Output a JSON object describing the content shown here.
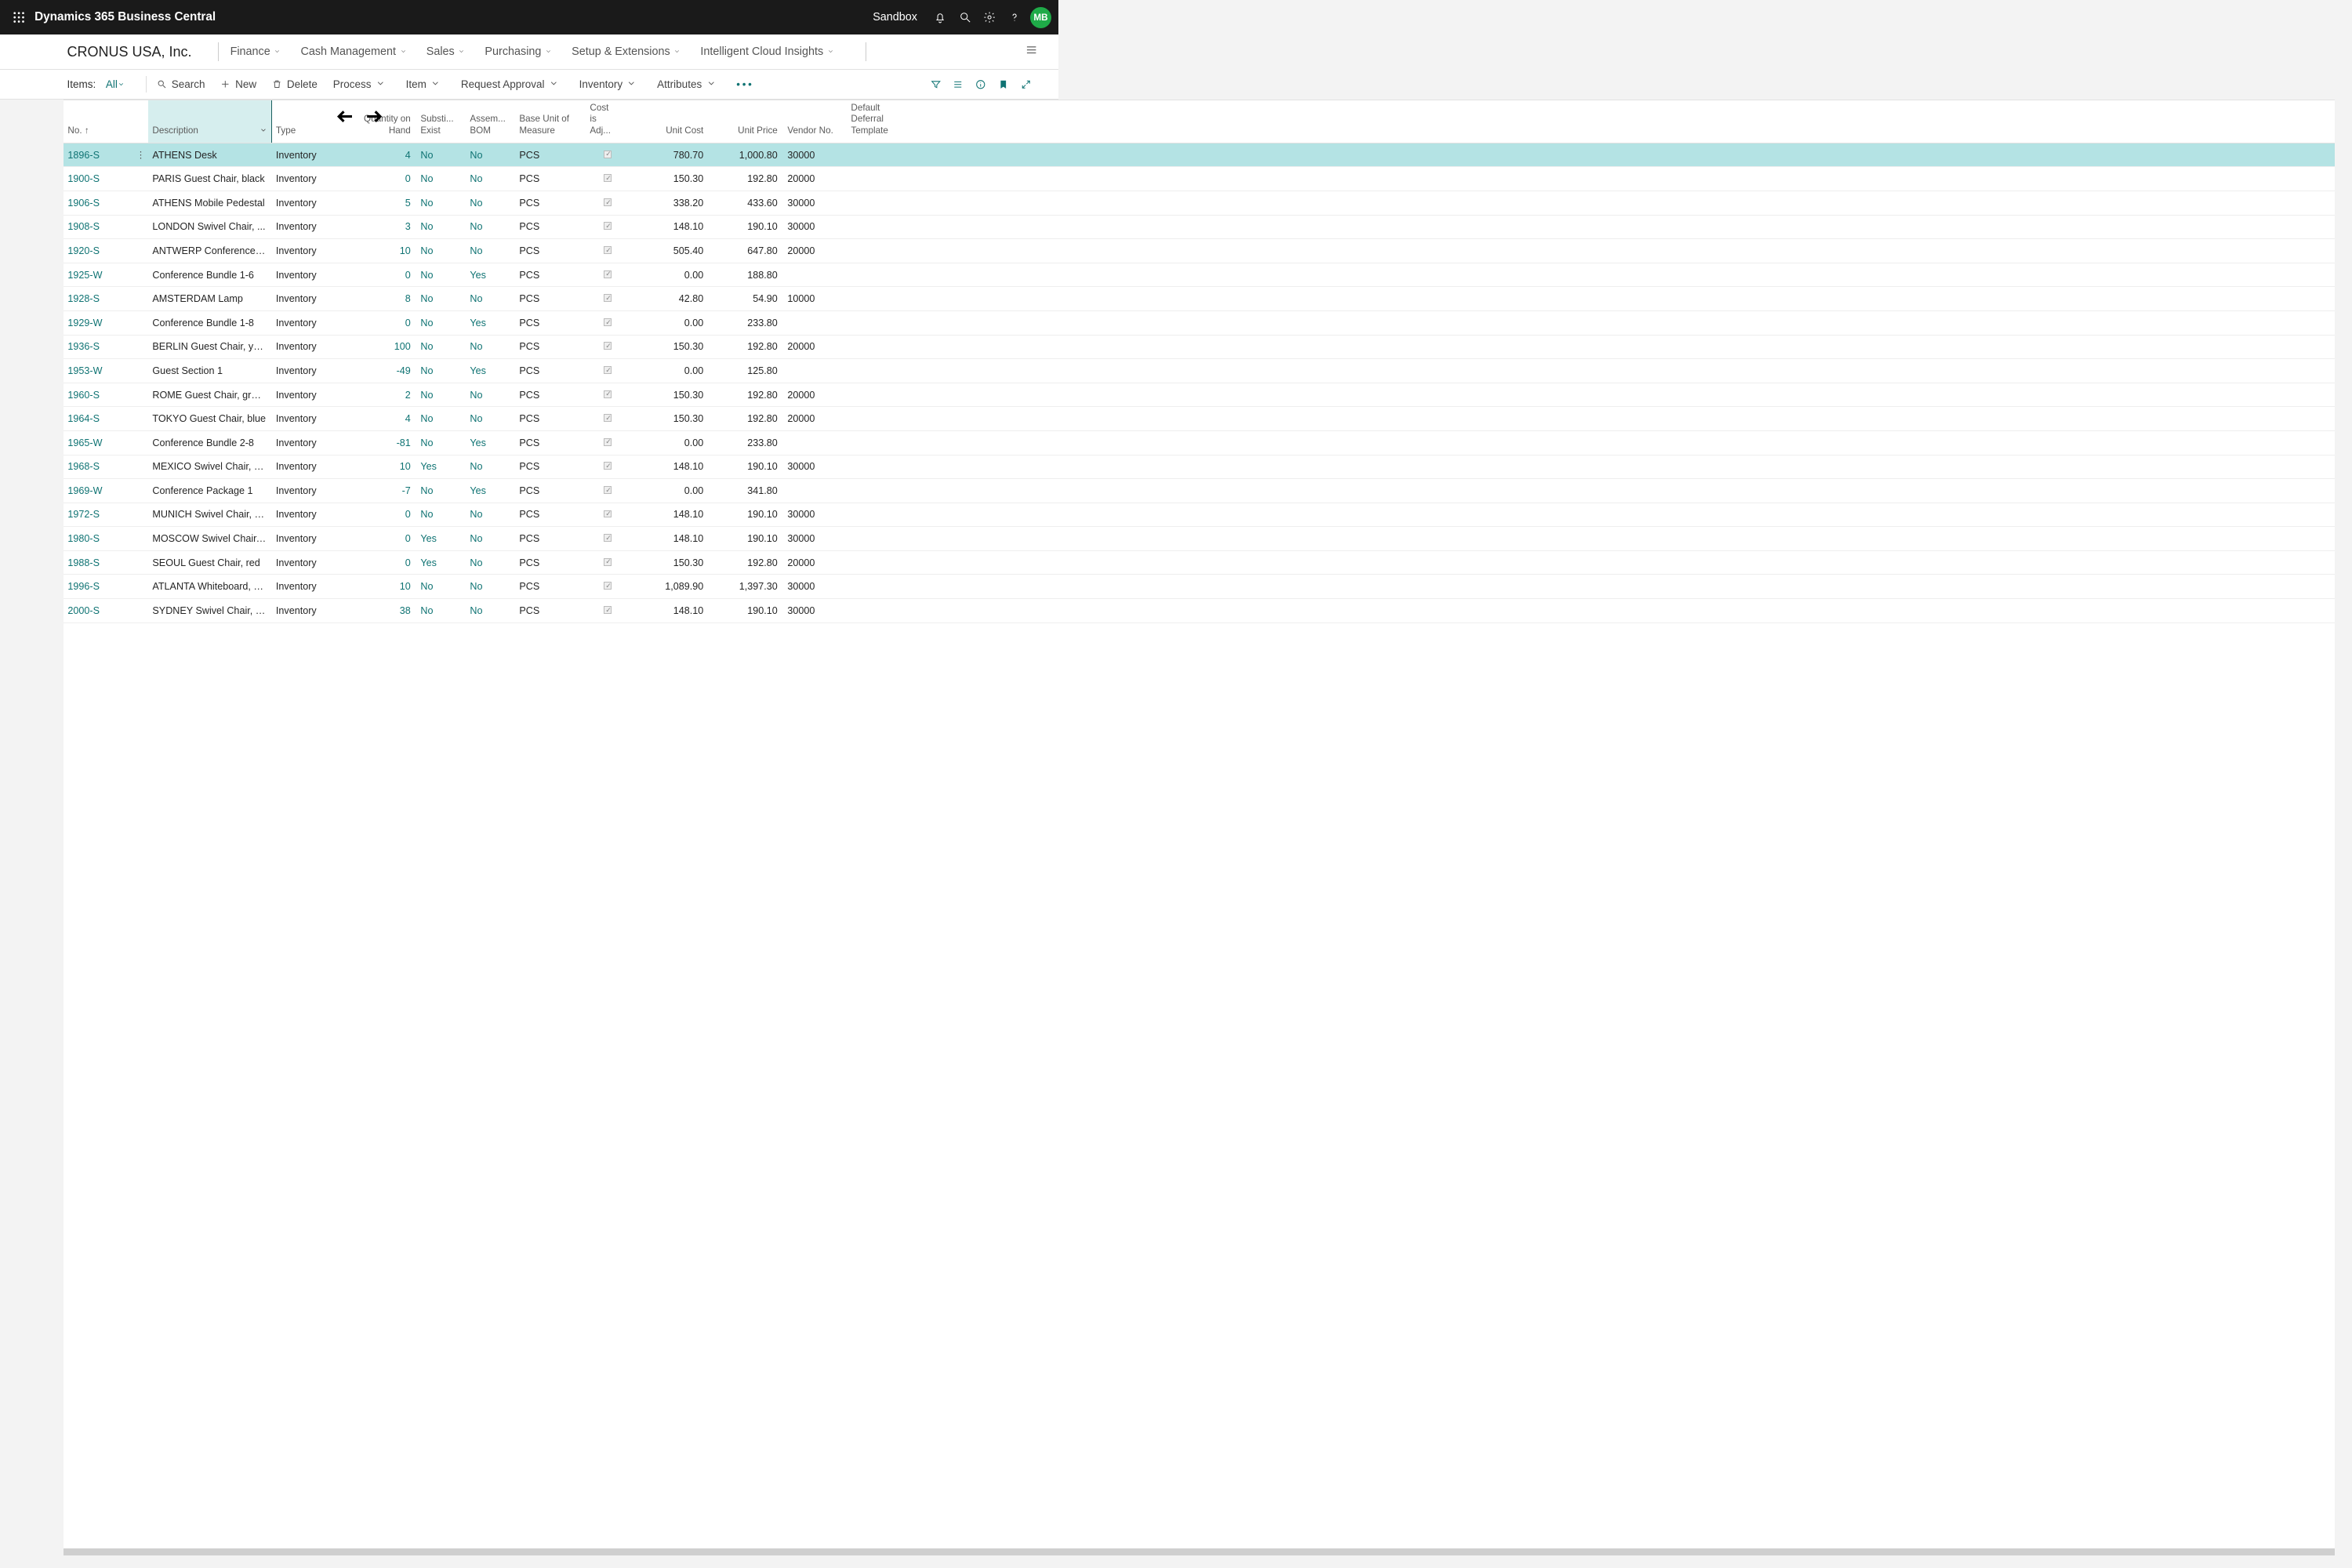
{
  "topbar": {
    "app_title": "Dynamics 365 Business Central",
    "env": "Sandbox",
    "avatar": "MB"
  },
  "nav": {
    "company": "CRONUS USA, Inc.",
    "items": [
      "Finance",
      "Cash Management",
      "Sales",
      "Purchasing",
      "Setup & Extensions",
      "Intelligent Cloud Insights"
    ]
  },
  "actionbar": {
    "label": "Items:",
    "view": "All",
    "search": "Search",
    "new": "New",
    "delete": "Delete",
    "process": "Process",
    "item": "Item",
    "request_approval": "Request Approval",
    "inventory": "Inventory",
    "attributes": "Attributes"
  },
  "columns": {
    "no": "No. ↑",
    "description": "Description",
    "type": "Type",
    "qty": "Quantity on Hand",
    "substi": "Substi...\nExist",
    "assem": "Assem...\nBOM",
    "base_unit": "Base Unit of\nMeasure",
    "cost_adj": "Cost\nis\nAdj...",
    "unit_cost": "Unit Cost",
    "unit_price": "Unit Price",
    "vendor": "Vendor No.",
    "deferral": "Default\nDeferral\nTemplate"
  },
  "rows": [
    {
      "no": "1896-S",
      "desc": "ATHENS Desk",
      "type": "Inventory",
      "qty": "4",
      "sub": "No",
      "asm": "No",
      "uom": "PCS",
      "adj": true,
      "cost": "780.70",
      "price": "1,000.80",
      "vendor": "30000",
      "def": "",
      "sel": true
    },
    {
      "no": "1900-S",
      "desc": "PARIS Guest Chair, black",
      "type": "Inventory",
      "qty": "0",
      "sub": "No",
      "asm": "No",
      "uom": "PCS",
      "adj": true,
      "cost": "150.30",
      "price": "192.80",
      "vendor": "20000",
      "def": ""
    },
    {
      "no": "1906-S",
      "desc": "ATHENS Mobile Pedestal",
      "type": "Inventory",
      "qty": "5",
      "sub": "No",
      "asm": "No",
      "uom": "PCS",
      "adj": true,
      "cost": "338.20",
      "price": "433.60",
      "vendor": "30000",
      "def": ""
    },
    {
      "no": "1908-S",
      "desc": "LONDON Swivel Chair, ...",
      "type": "Inventory",
      "qty": "3",
      "sub": "No",
      "asm": "No",
      "uom": "PCS",
      "adj": true,
      "cost": "148.10",
      "price": "190.10",
      "vendor": "30000",
      "def": ""
    },
    {
      "no": "1920-S",
      "desc": "ANTWERP Conference T...",
      "type": "Inventory",
      "qty": "10",
      "sub": "No",
      "asm": "No",
      "uom": "PCS",
      "adj": true,
      "cost": "505.40",
      "price": "647.80",
      "vendor": "20000",
      "def": ""
    },
    {
      "no": "1925-W",
      "desc": "Conference Bundle 1-6",
      "type": "Inventory",
      "qty": "0",
      "sub": "No",
      "asm": "Yes",
      "uom": "PCS",
      "adj": true,
      "cost": "0.00",
      "price": "188.80",
      "vendor": "",
      "def": ""
    },
    {
      "no": "1928-S",
      "desc": "AMSTERDAM Lamp",
      "type": "Inventory",
      "qty": "8",
      "sub": "No",
      "asm": "No",
      "uom": "PCS",
      "adj": true,
      "cost": "42.80",
      "price": "54.90",
      "vendor": "10000",
      "def": ""
    },
    {
      "no": "1929-W",
      "desc": "Conference Bundle 1-8",
      "type": "Inventory",
      "qty": "0",
      "sub": "No",
      "asm": "Yes",
      "uom": "PCS",
      "adj": true,
      "cost": "0.00",
      "price": "233.80",
      "vendor": "",
      "def": ""
    },
    {
      "no": "1936-S",
      "desc": "BERLIN Guest Chair, yell...",
      "type": "Inventory",
      "qty": "100",
      "sub": "No",
      "asm": "No",
      "uom": "PCS",
      "adj": true,
      "cost": "150.30",
      "price": "192.80",
      "vendor": "20000",
      "def": ""
    },
    {
      "no": "1953-W",
      "desc": "Guest Section 1",
      "type": "Inventory",
      "qty": "-49",
      "sub": "No",
      "asm": "Yes",
      "uom": "PCS",
      "adj": true,
      "cost": "0.00",
      "price": "125.80",
      "vendor": "",
      "def": ""
    },
    {
      "no": "1960-S",
      "desc": "ROME Guest Chair, green",
      "type": "Inventory",
      "qty": "2",
      "sub": "No",
      "asm": "No",
      "uom": "PCS",
      "adj": true,
      "cost": "150.30",
      "price": "192.80",
      "vendor": "20000",
      "def": ""
    },
    {
      "no": "1964-S",
      "desc": "TOKYO Guest Chair, blue",
      "type": "Inventory",
      "qty": "4",
      "sub": "No",
      "asm": "No",
      "uom": "PCS",
      "adj": true,
      "cost": "150.30",
      "price": "192.80",
      "vendor": "20000",
      "def": ""
    },
    {
      "no": "1965-W",
      "desc": "Conference Bundle 2-8",
      "type": "Inventory",
      "qty": "-81",
      "sub": "No",
      "asm": "Yes",
      "uom": "PCS",
      "adj": true,
      "cost": "0.00",
      "price": "233.80",
      "vendor": "",
      "def": ""
    },
    {
      "no": "1968-S",
      "desc": "MEXICO Swivel Chair, bl...",
      "type": "Inventory",
      "qty": "10",
      "sub": "Yes",
      "asm": "No",
      "uom": "PCS",
      "adj": true,
      "cost": "148.10",
      "price": "190.10",
      "vendor": "30000",
      "def": ""
    },
    {
      "no": "1969-W",
      "desc": "Conference Package 1",
      "type": "Inventory",
      "qty": "-7",
      "sub": "No",
      "asm": "Yes",
      "uom": "PCS",
      "adj": true,
      "cost": "0.00",
      "price": "341.80",
      "vendor": "",
      "def": ""
    },
    {
      "no": "1972-S",
      "desc": "MUNICH Swivel Chair, y...",
      "type": "Inventory",
      "qty": "0",
      "sub": "No",
      "asm": "No",
      "uom": "PCS",
      "adj": true,
      "cost": "148.10",
      "price": "190.10",
      "vendor": "30000",
      "def": ""
    },
    {
      "no": "1980-S",
      "desc": "MOSCOW Swivel Chair, ...",
      "type": "Inventory",
      "qty": "0",
      "sub": "Yes",
      "asm": "No",
      "uom": "PCS",
      "adj": true,
      "cost": "148.10",
      "price": "190.10",
      "vendor": "30000",
      "def": ""
    },
    {
      "no": "1988-S",
      "desc": "SEOUL Guest Chair, red",
      "type": "Inventory",
      "qty": "0",
      "sub": "Yes",
      "asm": "No",
      "uom": "PCS",
      "adj": true,
      "cost": "150.30",
      "price": "192.80",
      "vendor": "20000",
      "def": ""
    },
    {
      "no": "1996-S",
      "desc": "ATLANTA Whiteboard, b...",
      "type": "Inventory",
      "qty": "10",
      "sub": "No",
      "asm": "No",
      "uom": "PCS",
      "adj": true,
      "cost": "1,089.90",
      "price": "1,397.30",
      "vendor": "30000",
      "def": ""
    },
    {
      "no": "2000-S",
      "desc": "SYDNEY Swivel Chair, gr...",
      "type": "Inventory",
      "qty": "38",
      "sub": "No",
      "asm": "No",
      "uom": "PCS",
      "adj": true,
      "cost": "148.10",
      "price": "190.10",
      "vendor": "30000",
      "def": ""
    }
  ]
}
